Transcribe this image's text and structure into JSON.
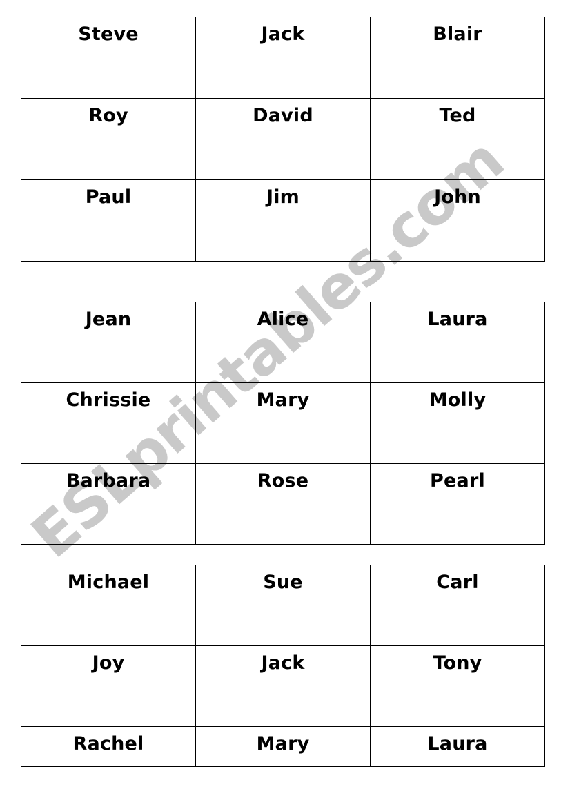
{
  "page": {
    "background_color": "#ffffff",
    "text_color": "#000000",
    "border_color": "#000000"
  },
  "watermark": {
    "text": "ESLprintables.com",
    "color": "#c9c9c9",
    "rotation_degrees": -41
  },
  "tables": [
    {
      "id": "table-1",
      "name": "names-grid-male",
      "rows": [
        {
          "cells": [
            "Steve",
            "Jack",
            "Blair"
          ]
        },
        {
          "cells": [
            "Roy",
            "David",
            "Ted"
          ]
        },
        {
          "cells": [
            "Paul",
            "Jim",
            "John"
          ]
        }
      ]
    },
    {
      "id": "table-2",
      "name": "names-grid-female",
      "rows": [
        {
          "cells": [
            "Jean",
            "Alice",
            "Laura"
          ]
        },
        {
          "cells": [
            "Chrissie",
            "Mary",
            "Molly"
          ]
        },
        {
          "cells": [
            "Barbara",
            "Rose",
            "Pearl"
          ]
        }
      ]
    },
    {
      "id": "table-3",
      "name": "names-grid-mixed",
      "rows": [
        {
          "cells": [
            "Michael",
            "Sue",
            "Carl"
          ]
        },
        {
          "cells": [
            "Joy",
            "Jack",
            "Tony"
          ]
        },
        {
          "cells": [
            "Rachel",
            "Mary",
            "Laura"
          ]
        }
      ]
    }
  ]
}
